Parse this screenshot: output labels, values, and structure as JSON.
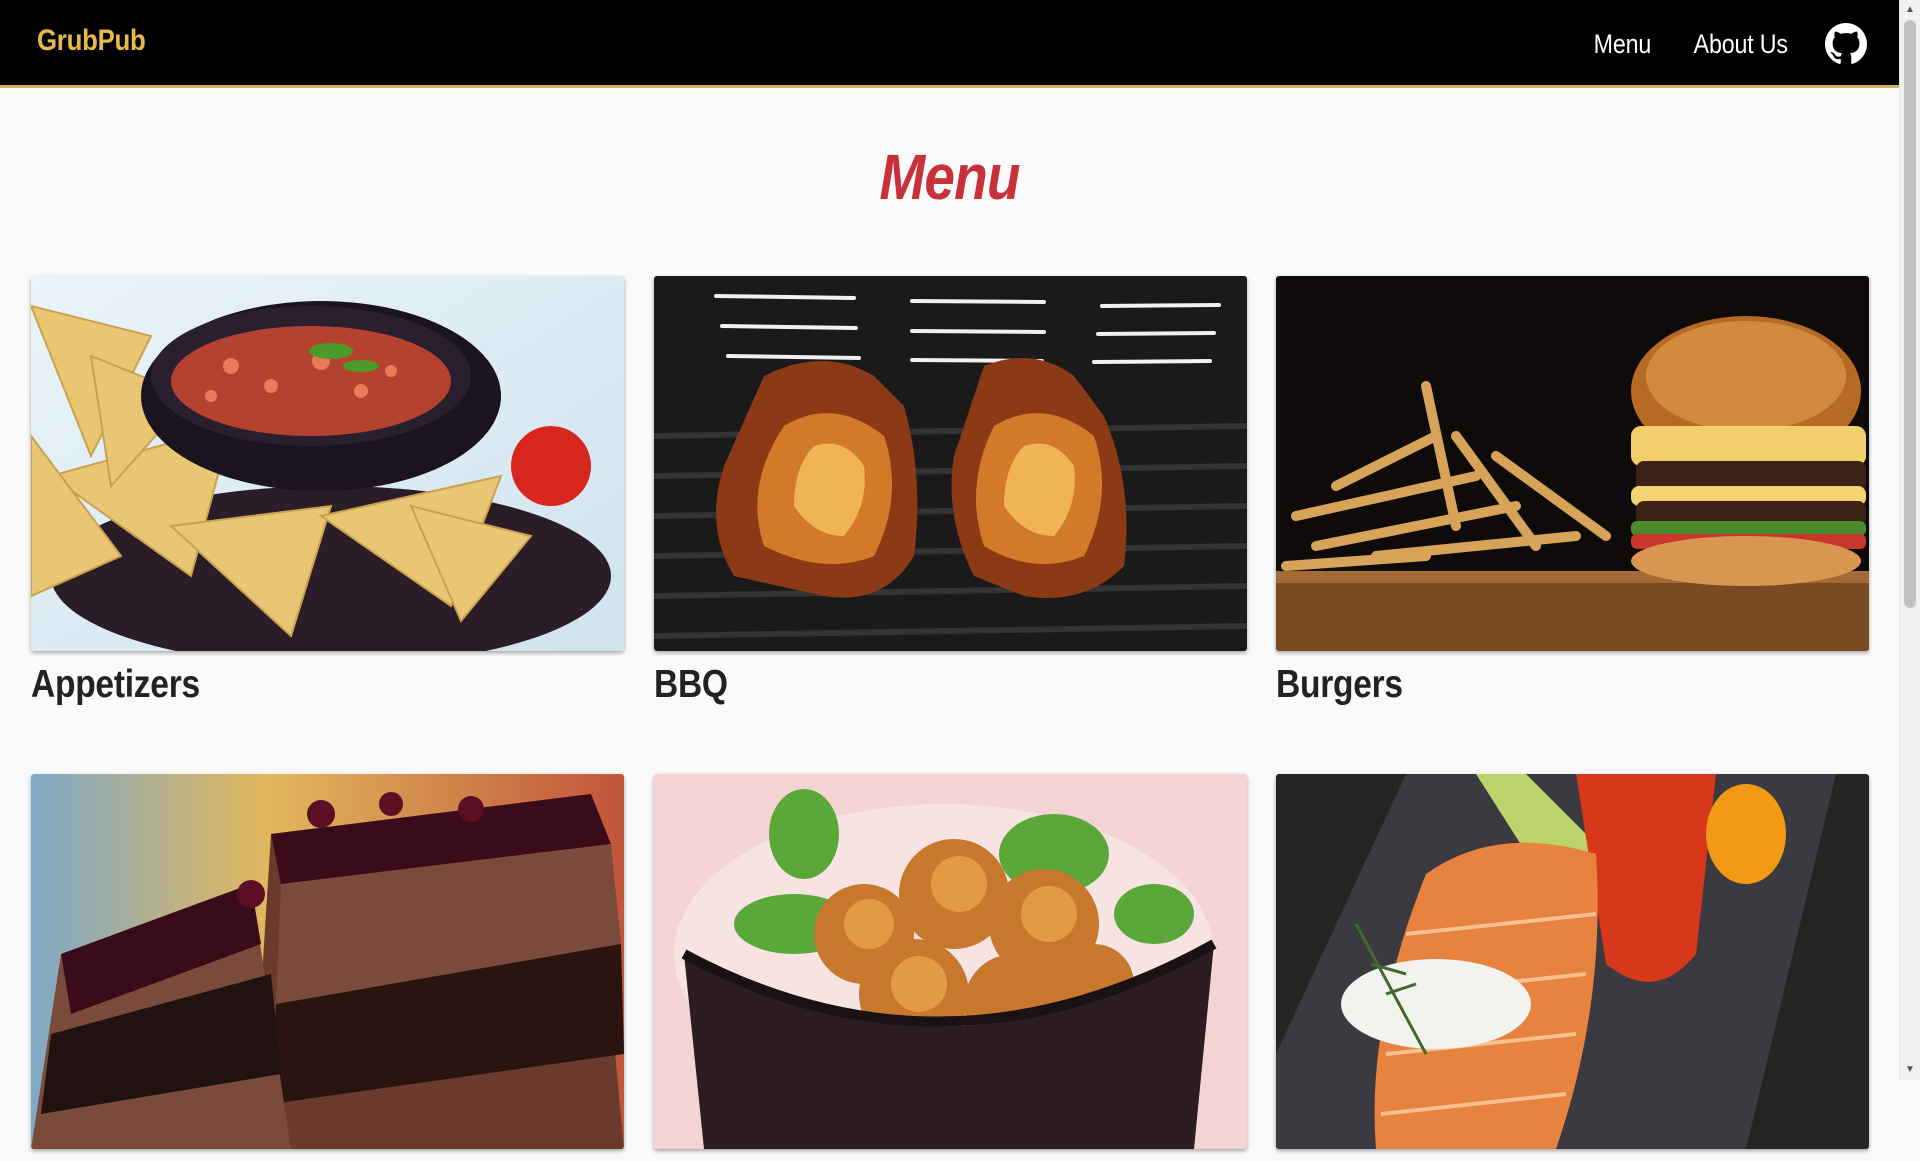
{
  "navbar": {
    "brand": "GrubPub",
    "links": [
      "Menu",
      "About Us"
    ],
    "github_icon": "github-icon",
    "accent_color": "#d4b15a",
    "brand_color": "#e7b84c"
  },
  "page": {
    "title": "Menu",
    "title_color": "#c8313a"
  },
  "categories": [
    {
      "label": "Appetizers",
      "image": "chips-and-salsa"
    },
    {
      "label": "BBQ",
      "image": "grilled-ribs"
    },
    {
      "label": "Burgers",
      "image": "burger-and-fries"
    },
    {
      "label": "",
      "image": "chocolate-cake"
    },
    {
      "label": "",
      "image": "fried-chicken-basket"
    },
    {
      "label": "",
      "image": "grilled-salmon"
    }
  ]
}
